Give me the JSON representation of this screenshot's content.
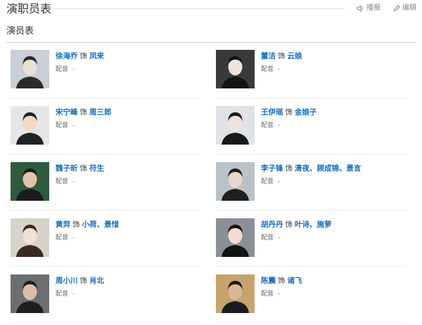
{
  "page": {
    "title": "演职员表",
    "toolbar": {
      "play_label": "播报",
      "edit_label": "编辑",
      "play_icon": "speaker-icon",
      "edit_icon": "pencil-icon"
    },
    "section_title": "演员表"
  },
  "cast": [
    {
      "actor": "徐海乔",
      "role_word": "饰",
      "role": "凤来",
      "dub_label": "配音",
      "dub_value": "-"
    },
    {
      "actor": "董洁",
      "role_word": "饰",
      "role": "云娘",
      "dub_label": "配音",
      "dub_value": "-"
    },
    {
      "actor": "宋宁峰",
      "role_word": "饰",
      "role": "周三郎",
      "dub_label": "配音",
      "dub_value": "-"
    },
    {
      "actor": "王伊瑶",
      "role_word": "饰",
      "role": "金娘子",
      "dub_label": "配音",
      "dub_value": "-"
    },
    {
      "actor": "魏子昕",
      "role_word": "饰",
      "role": "苻生",
      "dub_label": "配音",
      "dub_value": "-"
    },
    {
      "actor": "李子锋",
      "role_word": "饰",
      "role": "清夜、顾成锦、景言",
      "dub_label": "配音",
      "dub_value": "-"
    },
    {
      "actor": "黄羿",
      "role_word": "饰",
      "role": "小荷、景惜",
      "dub_label": "配音",
      "dub_value": "-"
    },
    {
      "actor": "胡丹丹",
      "role_word": "饰",
      "role": "叶诗、施萝",
      "dub_label": "配音",
      "dub_value": "-"
    },
    {
      "actor": "周小川",
      "role_word": "饰",
      "role": "肖北",
      "dub_label": "配音",
      "dub_value": "-"
    },
    {
      "actor": "陈震",
      "role_word": "饰",
      "role": "诸飞",
      "dub_label": "配音",
      "dub_value": "-"
    }
  ],
  "colors": {
    "link": "#136ec2",
    "text": "#333333",
    "muted": "#666666",
    "divider": "#ececec"
  }
}
